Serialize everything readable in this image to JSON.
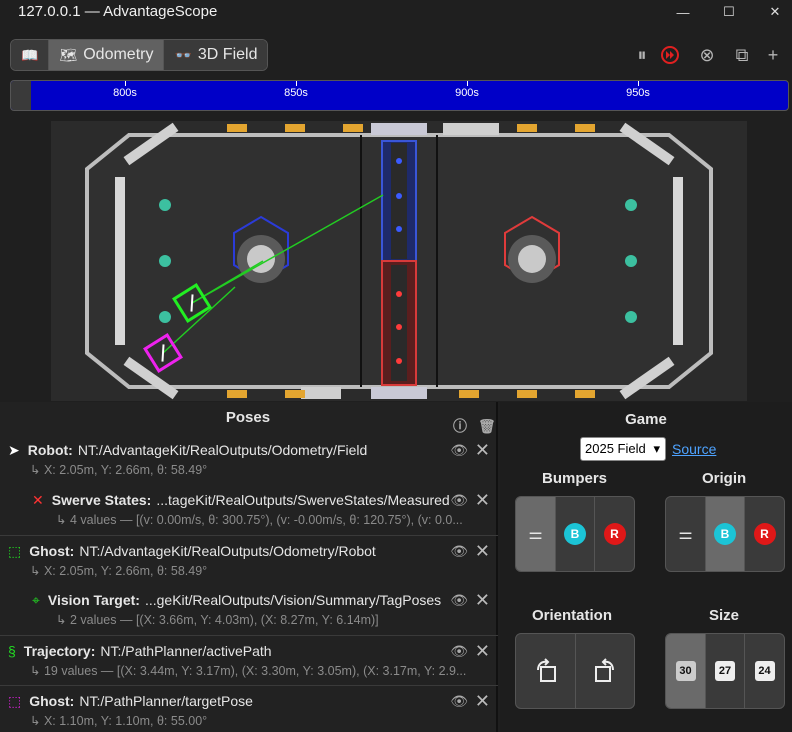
{
  "window": {
    "title": "127.0.0.1 — AdvantageScope"
  },
  "tabs": [
    {
      "label": "",
      "icon": "book-icon"
    },
    {
      "label": "Odometry",
      "icon": "map-icon"
    },
    {
      "label": "3D Field",
      "icon": "binoculars-icon"
    }
  ],
  "timeline": {
    "ticks": [
      "800s",
      "850s",
      "900s",
      "950s"
    ]
  },
  "poses": {
    "header": "Poses",
    "items": [
      {
        "key": "Robot:",
        "path": "NT:/AdvantageKit/RealOutputs/Odometry/Field",
        "detail": "X: 2.05m, Y: 2.66m, θ: 58.49°",
        "color": "#ffffff",
        "icon": "arrow-icon"
      },
      {
        "key": "Swerve States:",
        "path": "...tageKit/RealOutputs/SwerveStates/Measured",
        "detail": "4 values — [(v: 0.00m/s, θ: 300.75°), (v: -0.00m/s, θ: 120.75°), (v: 0.0...",
        "color": "#ff3333",
        "icon": "swerve-icon"
      },
      {
        "key": "Ghost:",
        "path": "NT:/AdvantageKit/RealOutputs/Odometry/Robot",
        "detail": "X: 2.05m, Y: 2.66m, θ: 58.49°",
        "color": "#22dd22",
        "icon": "ghost-icon"
      },
      {
        "key": "Vision Target:",
        "path": "...geKit/RealOutputs/Vision/Summary/TagPoses",
        "detail": "2 values — [(X: 3.66m, Y: 4.03m), (X: 8.27m, Y: 6.14m)]",
        "color": "#22dd22",
        "icon": "crosshair-icon"
      },
      {
        "key": "Trajectory:",
        "path": "NT:/PathPlanner/activePath",
        "detail": "19 values — [(X: 3.44m, Y: 3.17m), (X: 3.30m, Y: 3.05m), (X: 3.17m, Y: 2.9...",
        "color": "#22dd22",
        "icon": "trajectory-icon"
      },
      {
        "key": "Ghost:",
        "path": "NT:/PathPlanner/targetPose",
        "detail": "X: 1.10m, Y: 1.10m, θ: 55.00°",
        "color": "#dd22dd",
        "icon": "ghost-icon"
      }
    ]
  },
  "game": {
    "header": "Game",
    "field_select": "2025 Field",
    "source_link": "Source",
    "bumpers_label": "Bumpers",
    "origin_label": "Origin",
    "orientation_label": "Orientation",
    "size_label": "Size",
    "blue_letter": "B",
    "red_letter": "R",
    "sizes": [
      "30",
      "27",
      "24"
    ]
  }
}
